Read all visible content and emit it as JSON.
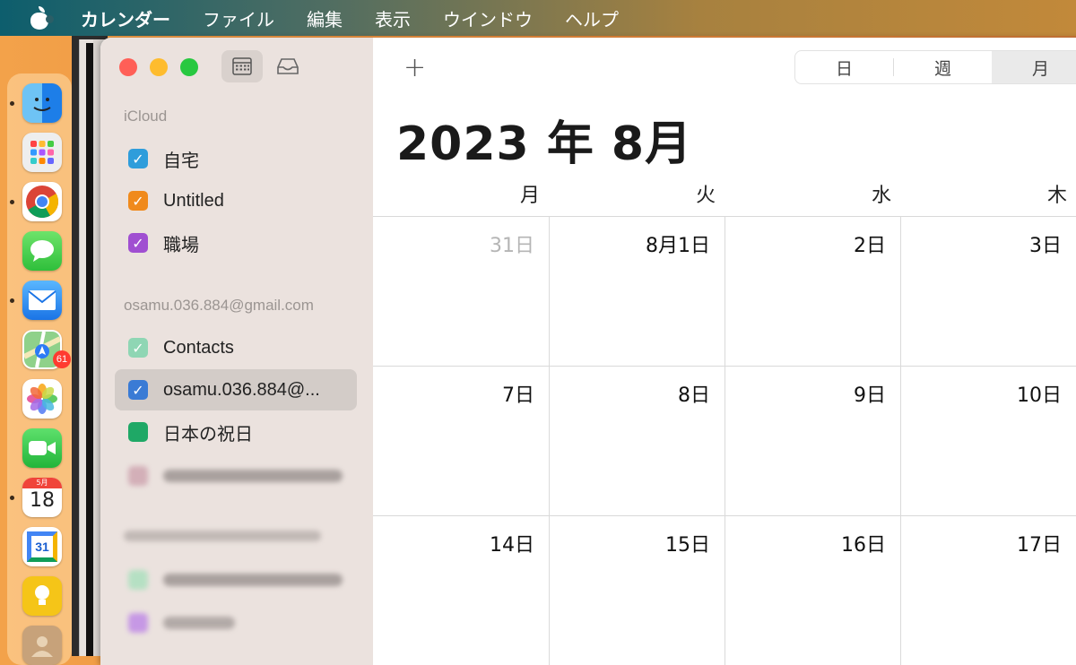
{
  "menubar": {
    "app_name": "カレンダー",
    "items": [
      "ファイル",
      "編集",
      "表示",
      "ウインドウ",
      "ヘルプ"
    ]
  },
  "dock": {
    "calendar_icon_month": "5月",
    "calendar_icon_day": "18",
    "google_calendar_day": "31",
    "mail_badge": "61"
  },
  "sidebar": {
    "icloud_title": "iCloud",
    "icloud_calendars": [
      {
        "label": "自宅",
        "color": "#2f9ddb",
        "checked": true
      },
      {
        "label": "Untitled",
        "color": "#f08a1c",
        "checked": true
      },
      {
        "label": "職場",
        "color": "#a04fd1",
        "checked": true
      }
    ],
    "gmail_title": "osamu.036.884@gmail.com",
    "gmail_calendars": [
      {
        "label": "Contacts",
        "color": "#8fd6b4",
        "checked": true
      },
      {
        "label": "osamu.036.884@...",
        "color": "#3a7bd5",
        "checked": true
      },
      {
        "label": "日本の祝日",
        "color": "#1fa866",
        "checked": false
      }
    ]
  },
  "toolbar": {
    "add_label": "+",
    "views": [
      {
        "label": "日",
        "active": false
      },
      {
        "label": "週",
        "active": false
      },
      {
        "label": "月",
        "active": true
      }
    ]
  },
  "calendar": {
    "title": "2023 年 8月",
    "weekdays": [
      "月",
      "火",
      "水",
      "木"
    ],
    "weeks": [
      [
        {
          "label": "31日",
          "other": true
        },
        {
          "label": "8月1日"
        },
        {
          "label": "2日"
        },
        {
          "label": "3日"
        }
      ],
      [
        {
          "label": "7日"
        },
        {
          "label": "8日"
        },
        {
          "label": "9日"
        },
        {
          "label": "10日"
        }
      ],
      [
        {
          "label": "14日"
        },
        {
          "label": "15日"
        },
        {
          "label": "16日"
        },
        {
          "label": "17日"
        }
      ]
    ]
  }
}
